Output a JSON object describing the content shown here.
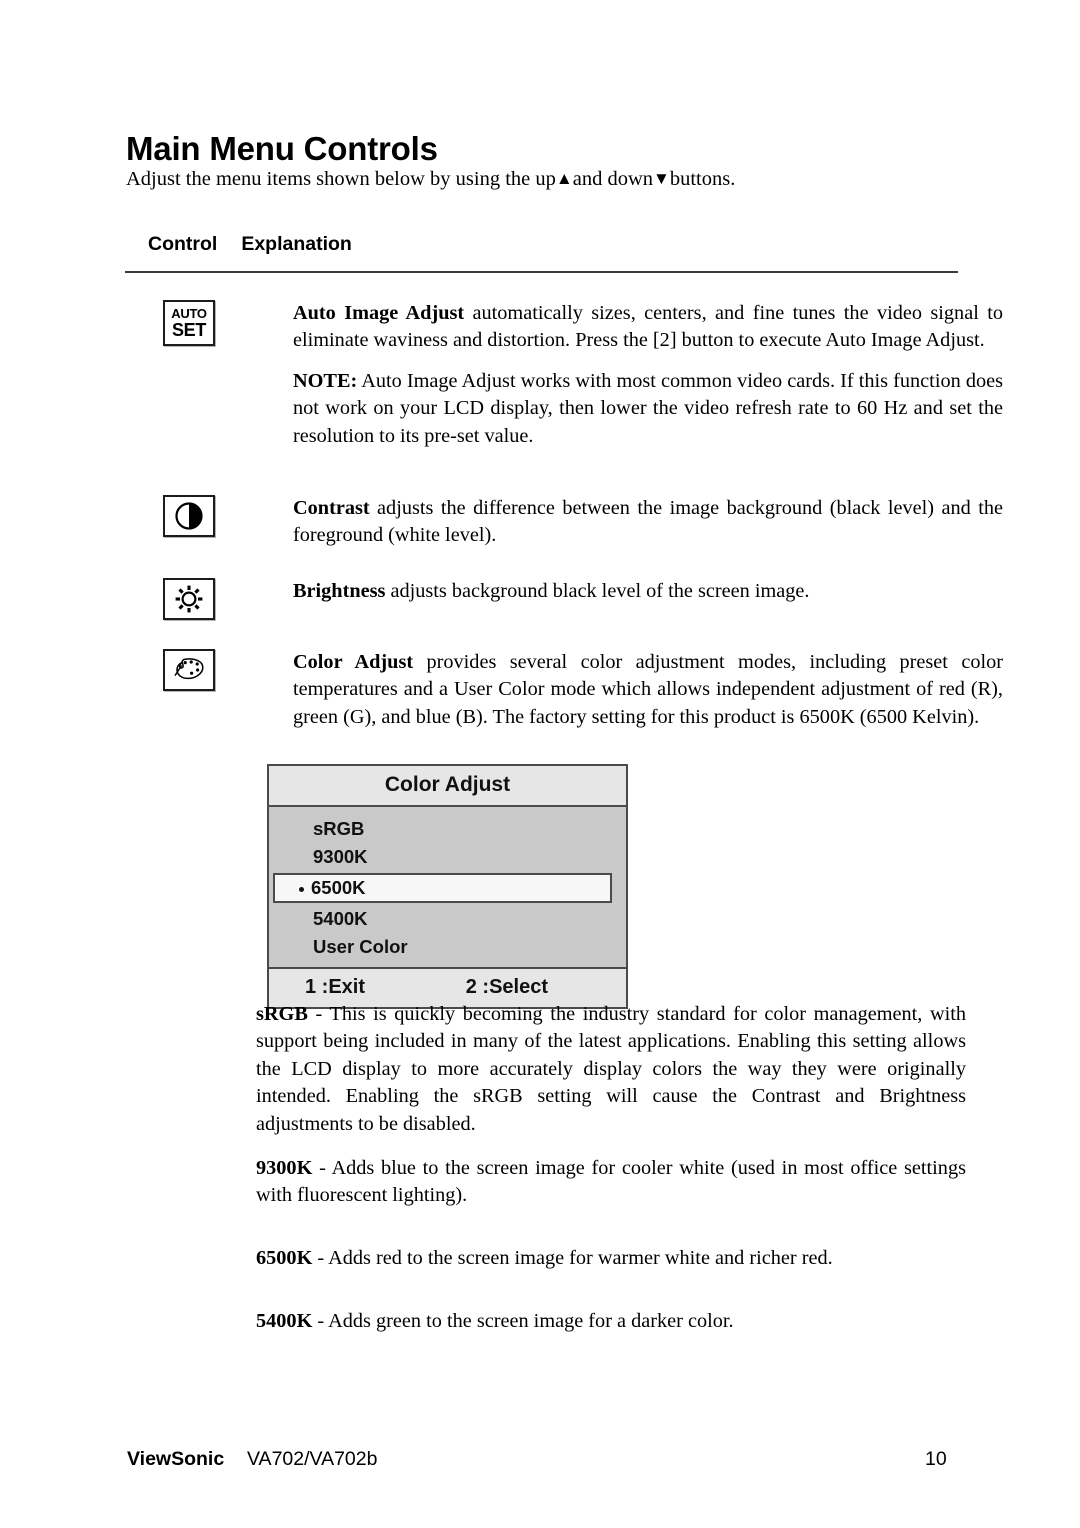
{
  "document": {
    "title": "Main Menu Controls",
    "intro_before": "Adjust the menu items shown below by using the up",
    "intro_mid": "and down",
    "intro_after": "buttons.",
    "up_arrow": "▲",
    "down_arrow": "▼"
  },
  "columns": {
    "control": "Control",
    "explanation": "Explanation"
  },
  "controls": [
    {
      "icon": "auto-set-icon",
      "icon_text_top": "AUTO",
      "icon_text_bottom": "SET",
      "term": "Auto Image Adjust",
      "body": " automatically sizes, centers, and fine tunes the video signal to eliminate waviness and distortion. Press the [2] button to execute Auto Image Adjust.",
      "note_label": "NOTE:",
      "note_body": " Auto Image Adjust works with most common video cards. If this function does not work on your LCD display, then lower the video refresh rate to 60 Hz and set the resolution to its pre-set value."
    },
    {
      "icon": "contrast-icon",
      "term": "Contrast",
      "body": " adjusts the difference between the image background  (black level) and the foreground (white level)."
    },
    {
      "icon": "brightness-icon",
      "term": "Brightness",
      "body": " adjusts background black level of the screen image."
    },
    {
      "icon": "color-palette-icon",
      "term": "Color Adjust",
      "body": " provides several color adjustment modes, including preset color temperatures and a User Color mode which allows independent adjustment of red (R), green (G), and blue (B). The factory setting for this product is 6500K (6500 Kelvin)."
    }
  ],
  "osd": {
    "title": "Color Adjust",
    "items": [
      {
        "label": "sRGB",
        "selected": false
      },
      {
        "label": "9300K",
        "selected": false
      },
      {
        "label": "6500K",
        "selected": true
      },
      {
        "label": "5400K",
        "selected": false
      },
      {
        "label": "User Color",
        "selected": false
      }
    ],
    "footer_left": "1 :Exit",
    "footer_right": "2 :Select",
    "colors": {
      "title_bar": "#e6e6e6",
      "body": "#c9c9c9",
      "selected_row": "#f7f7f7",
      "border": "#4a4a4a"
    }
  },
  "descriptions": [
    {
      "term": "sRGB",
      "sep": " - ",
      "body": "This is quickly becoming the industry standard for color management, with support being included in many of the latest applications. Enabling this setting allows the LCD display to more accurately display colors the way they were originally intended. Enabling the sRGB setting will cause the Contrast and Brightness adjustments to be disabled."
    },
    {
      "term": "9300K",
      "sep": " - ",
      "body": "Adds blue to the screen image for cooler white (used in most office settings with fluorescent lighting)."
    },
    {
      "term": "6500K",
      "sep": " - ",
      "body": "Adds red to the screen image for warmer white and richer red."
    },
    {
      "term": "5400K",
      "sep": " - ",
      "body": "Adds green to the screen image for a darker color."
    }
  ],
  "footer": {
    "brand": "ViewSonic",
    "model": "VA702/VA702b",
    "page_number": "10"
  }
}
